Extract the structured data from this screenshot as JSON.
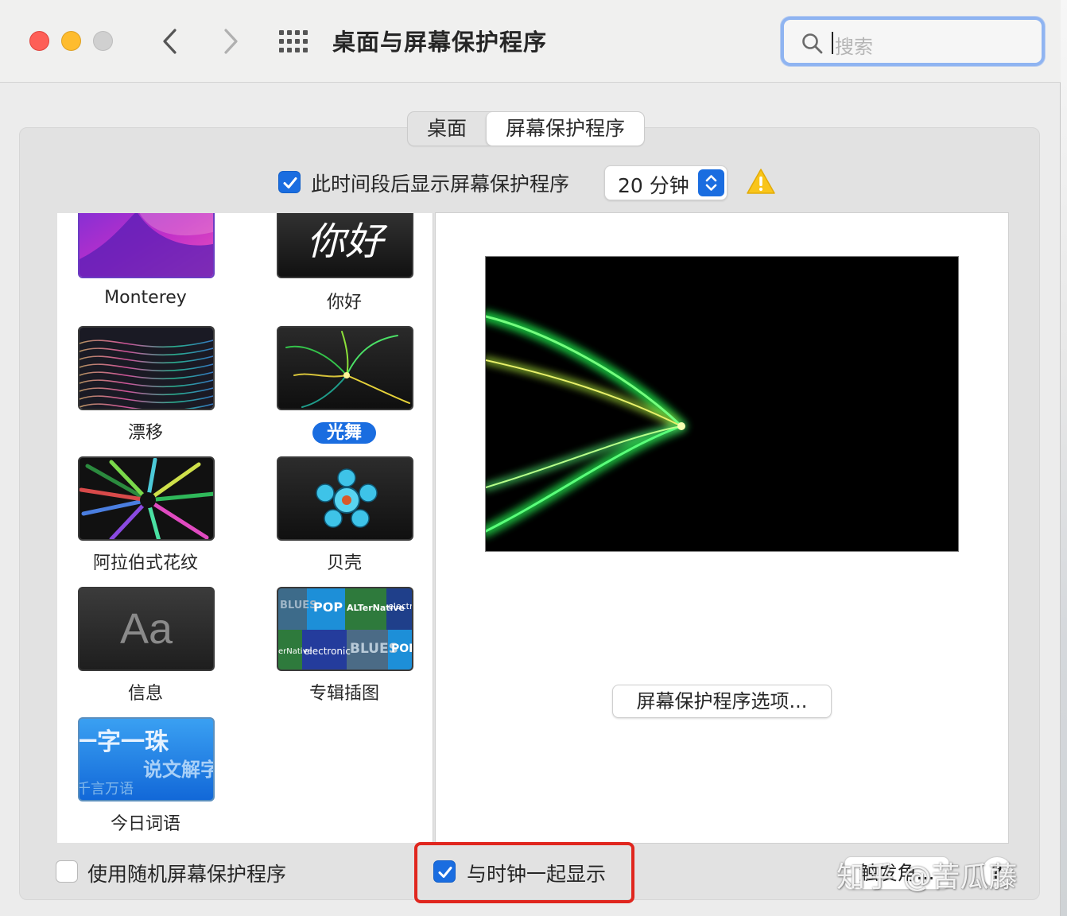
{
  "window": {
    "title": "桌面与屏幕保护程序",
    "search_placeholder": "搜索"
  },
  "tabs": [
    {
      "label": "桌面",
      "active": false
    },
    {
      "label": "屏幕保护程序",
      "active": true
    }
  ],
  "start_after": {
    "checked": true,
    "label": "此时间段后显示屏幕保护程序",
    "value": "20 分钟"
  },
  "screensavers": [
    {
      "name": "Monterey",
      "selected": false
    },
    {
      "name": "你好",
      "selected": false
    },
    {
      "name": "漂移",
      "selected": false
    },
    {
      "name": "光舞",
      "selected": true
    },
    {
      "name": "阿拉伯式花纹",
      "selected": false
    },
    {
      "name": "贝壳",
      "selected": false
    },
    {
      "name": "信息",
      "selected": false
    },
    {
      "name": "专辑插图",
      "selected": false
    },
    {
      "name": "今日词语",
      "selected": false
    }
  ],
  "thumb_text": {
    "hello": "你好",
    "message": "Aa",
    "word_line1": "一字一珠",
    "word_line2": "说文解字",
    "word_line3": "千言万语",
    "album_tiles": [
      "BLUES",
      "POP",
      "ALTerNative",
      "electro",
      "erNative",
      "electronic",
      "BLUES",
      "POP"
    ]
  },
  "options_button": "屏幕保护程序选项...",
  "random_saver": {
    "checked": false,
    "label": "使用随机屏幕保护程序"
  },
  "show_clock": {
    "checked": true,
    "label": "与时钟一起显示"
  },
  "hot_corners_button": "触发角...",
  "help_button": "?",
  "watermark": "知乎 @苦瓜藤",
  "colors": {
    "accent": "#1a6de0",
    "highlight_box": "#e0261e"
  }
}
